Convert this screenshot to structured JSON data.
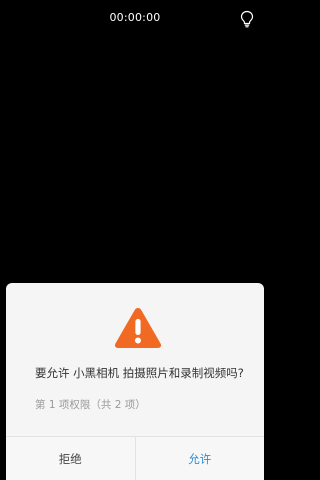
{
  "camera": {
    "timer": "00:00:00",
    "flash_icon": "lightbulb-icon"
  },
  "dialog": {
    "warning_icon": "warning-icon",
    "accent_color": "#f06a23",
    "message": "要允许 小黑相机 拍摄照片和录制视频吗?",
    "permission_count": "第 1 项权限（共 2 项）",
    "deny_label": "拒绝",
    "allow_label": "允许",
    "allow_color": "#2b8fd7"
  }
}
